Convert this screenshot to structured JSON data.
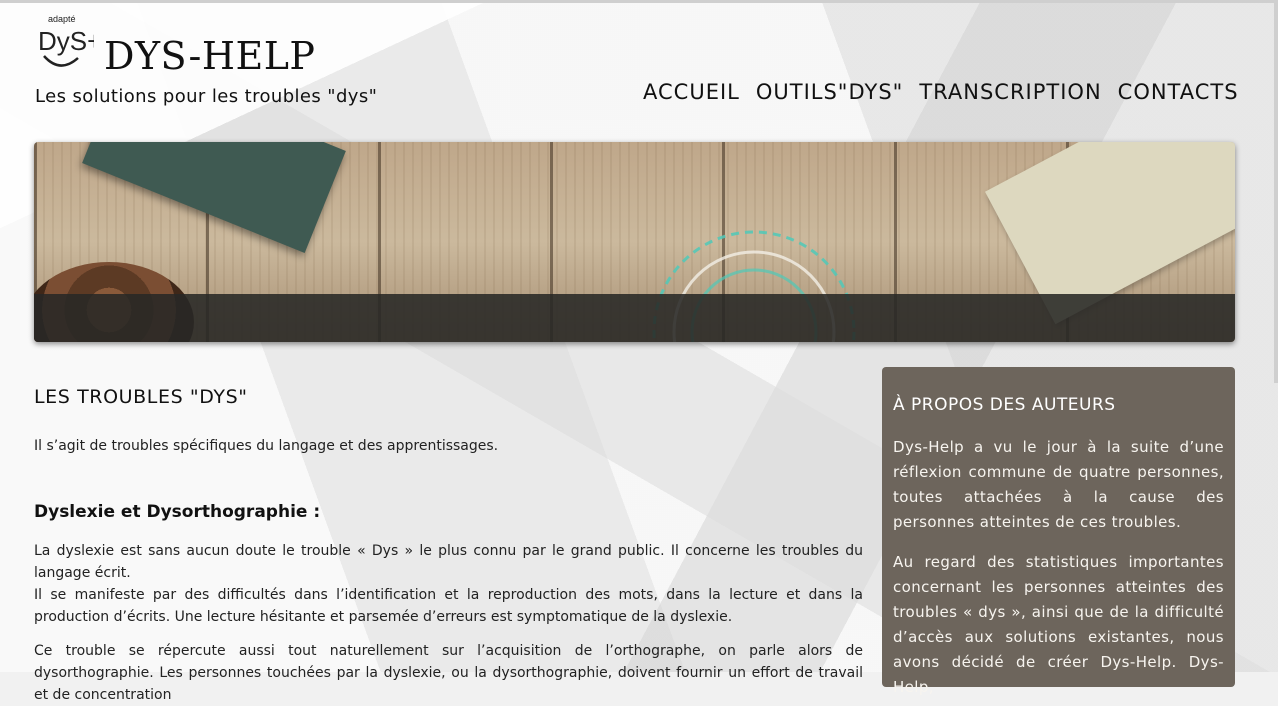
{
  "header": {
    "logo_top_text": "adapté",
    "logo_text": "DyS+",
    "site_title": "DYS-HELP",
    "tagline": "Les solutions pour les troubles \"dys\""
  },
  "nav": {
    "items": [
      {
        "label": "ACCUEIL"
      },
      {
        "label": "OUTILS\"DYS\""
      },
      {
        "label": "TRANSCRIPTION"
      },
      {
        "label": "CONTACTS"
      }
    ]
  },
  "colors": {
    "sidebar_bg": "#6d655c",
    "banner_accent": "#4fc9b8"
  },
  "main": {
    "title": "LES TROUBLES \"DYS\"",
    "intro": "Il s’agit de troubles spécifiques du langage et des apprentissages.",
    "section_title": "Dyslexie et Dysorthographie :",
    "para1_line1": "La dyslexie est sans aucun doute le trouble « Dys » le plus connu par le grand public. Il concerne les troubles du langage écrit.",
    "para2": "Il se manifeste par des difficultés dans l’identification et la reproduction des mots, dans la lecture et dans la production d’écrits. Une lecture hésitante et parsemée d’erreurs est symptomatique de la dyslexie.",
    "para3": "Ce trouble se répercute aussi tout naturellement sur l’acquisition de l’orthographe, on parle alors de dysorthographie. Les personnes touchées par la dyslexie, ou la dysorthographie, doivent fournir un effort de travail et de concentration"
  },
  "sidebar": {
    "title": "À PROPOS DES AUTEURS",
    "para1": "Dys-Help a vu le jour à la suite d’une réflexion commune de quatre personnes, toutes attachées à la cause des personnes atteintes de ces troubles.",
    "para2": "Au regard des statistiques importantes concernant les personnes atteintes des troubles « dys », ainsi que de la difficulté d’accès aux solutions existantes, nous avons décidé de créer Dys-Help. Dys-Help,"
  }
}
